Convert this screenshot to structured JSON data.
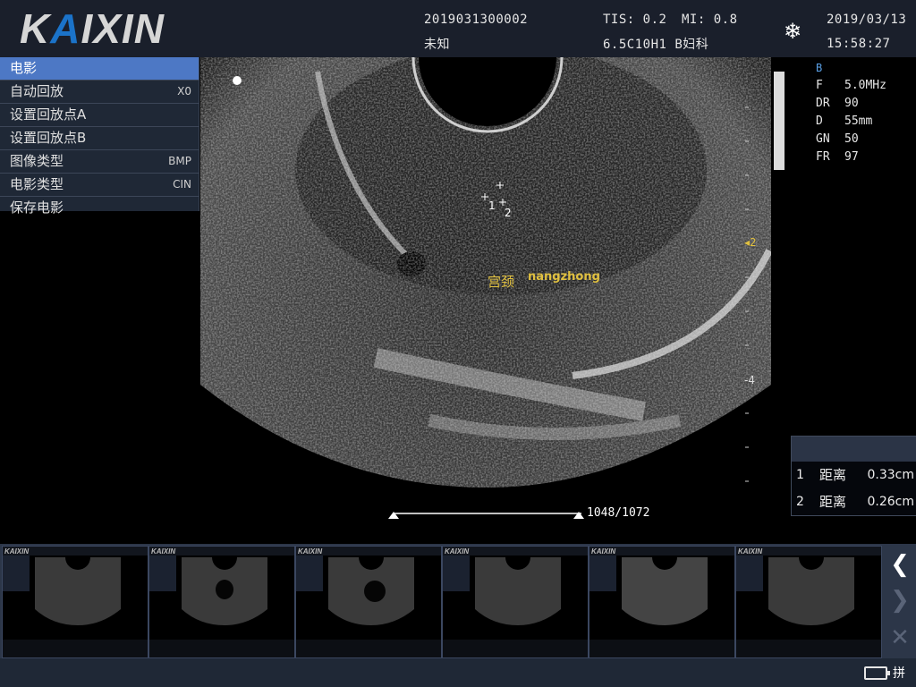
{
  "header": {
    "logo": "KAIXIN",
    "patient_id": "2019031300002",
    "patient_name": "未知",
    "tis": "TIS: 0.2",
    "mi": "MI: 0.8",
    "probe": "6.5C10H1 B妇科",
    "date": "2019/03/13",
    "time": "15:58:27",
    "freeze_icon": "snowflake-icon"
  },
  "menu": {
    "items": [
      {
        "label": "电影",
        "value": ""
      },
      {
        "label": "自动回放",
        "value": "X0"
      },
      {
        "label": "设置回放点A",
        "value": ""
      },
      {
        "label": "设置回放点B",
        "value": ""
      },
      {
        "label": "图像类型",
        "value": "BMP"
      },
      {
        "label": "电影类型",
        "value": "CIN"
      },
      {
        "label": "保存电影",
        "value": ""
      }
    ],
    "active_index": 0
  },
  "params": {
    "mode": "B",
    "rows": [
      {
        "label": "F",
        "value": "5.0MHz"
      },
      {
        "label": "DR",
        "value": "90"
      },
      {
        "label": "D",
        "value": "55mm"
      },
      {
        "label": "GN",
        "value": "50"
      },
      {
        "label": "FR",
        "value": "97"
      }
    ]
  },
  "scale": {
    "labels": [
      "2",
      "-4"
    ]
  },
  "image": {
    "annotation_cn": "宫颈",
    "annotation_en": "nangzhong",
    "caliper_labels": [
      "1",
      "2"
    ]
  },
  "measurements": [
    {
      "n": "1",
      "label": "距离",
      "value": "0.33cm"
    },
    {
      "n": "2",
      "label": "距离",
      "value": "0.26cm"
    }
  ],
  "cine": {
    "frames": "1048/1072"
  },
  "thumbnails": [
    {
      "label": "KAIXIN"
    },
    {
      "label": "KAIXIN"
    },
    {
      "label": "KAIXIN"
    },
    {
      "label": "KAIXIN"
    },
    {
      "label": "KAIXIN"
    },
    {
      "label": "KAIXIN"
    }
  ],
  "nav": {
    "prev_icon": "chevron-left-icon",
    "next_icon": "chevron-right-icon",
    "close_icon": "close-icon"
  },
  "footer": {
    "ime": "拼",
    "battery_icon": "battery-icon"
  },
  "colors": {
    "header_bg": "#1a1f2b",
    "menu_active": "#4d78c5",
    "annotation": "#e0c040",
    "logo_accent": "#1b73c9"
  }
}
